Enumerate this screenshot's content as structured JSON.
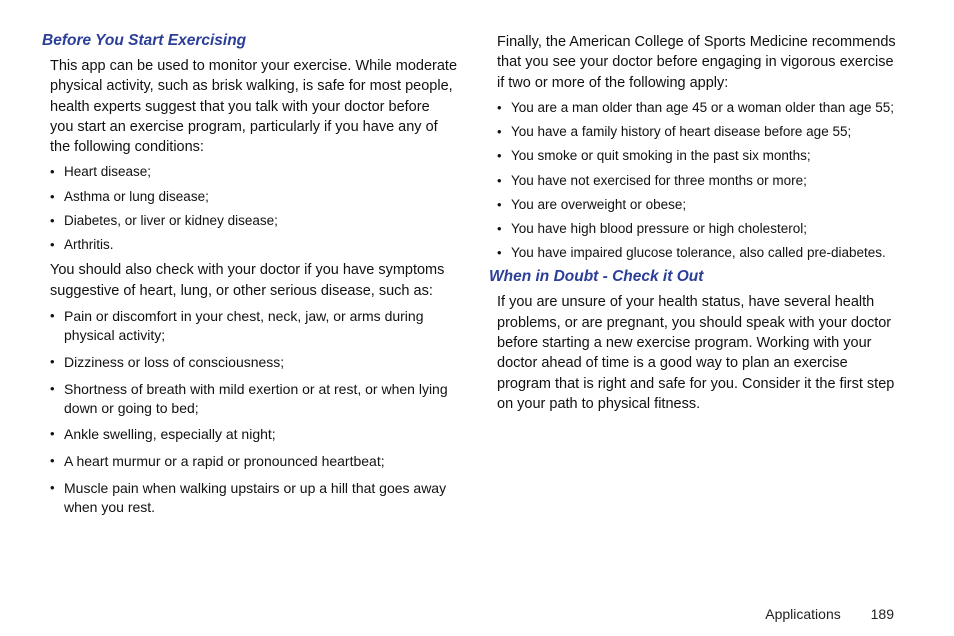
{
  "left": {
    "heading1": "Before You Start Exercising",
    "para1": "This app can be used to monitor your exercise. While moderate physical activity, such as brisk walking, is safe for most people, health experts suggest that you talk with your doctor before you start an exercise program, particularly if you have any of the following conditions:",
    "list1": [
      "Heart disease;",
      "Asthma or lung disease;",
      "Diabetes, or liver or kidney disease;",
      "Arthritis."
    ],
    "para2": "You should also check with your doctor if you have symptoms suggestive of heart, lung, or other serious disease, such as:",
    "list2": [
      "Pain or discomfort in your chest, neck, jaw, or arms during physical activity;",
      "Dizziness or loss of consciousness;",
      "Shortness of breath with mild exertion or at rest, or when lying down or going to bed;",
      "Ankle swelling, especially at night;",
      "A heart murmur or a rapid or pronounced heartbeat;",
      "Muscle pain when walking upstairs or up a hill that goes away when you rest."
    ]
  },
  "right": {
    "para1": "Finally, the American College of Sports Medicine recommends that you see your doctor before engaging in vigorous exercise if two or more of the following apply:",
    "list1": [
      "You are a man older than age 45 or a woman older than age 55;",
      "You have a family history of heart disease before age 55;",
      "You smoke or quit smoking in the past six months;",
      "You have not exercised for three months or more;",
      "You are overweight or obese;",
      "You have high blood pressure or high cholesterol;",
      "You have impaired glucose tolerance, also called pre-diabetes."
    ],
    "heading2": "When in Doubt - Check it Out",
    "para2": "If you are unsure of your health status, have several health problems, or are pregnant, you should speak with your doctor before starting a new exercise program. Working with your doctor ahead of time is a good way to plan an exercise program that is right and safe for you. Consider it the first step on your path to physical fitness."
  },
  "footer": {
    "section": "Applications",
    "page": "189"
  }
}
